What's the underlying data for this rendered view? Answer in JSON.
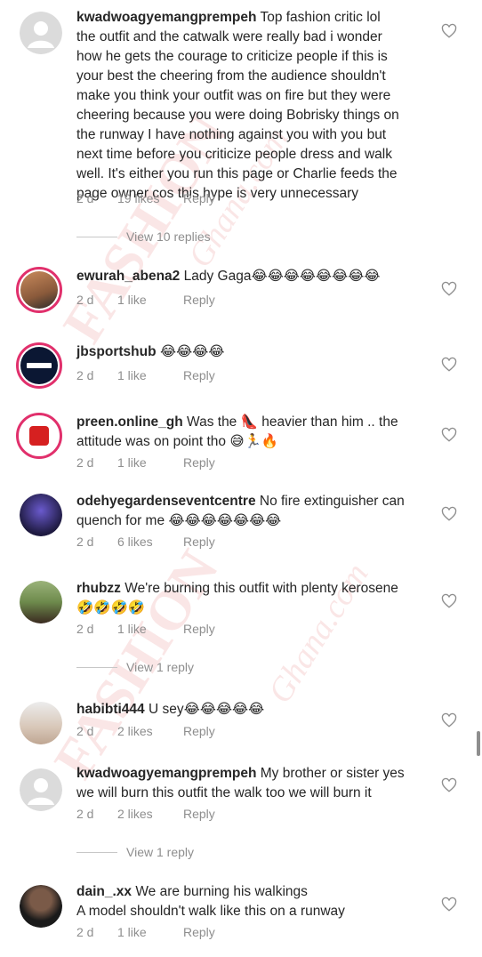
{
  "comments": [
    {
      "user": "kwadwoagyemangprempeh",
      "body_lines": [
        " Top fashion critic lol",
        "the outfit and the catwalk were really bad  i wonder",
        "how he gets the courage to criticize people if this is",
        "your best  the cheering from the audience shouldn't",
        "make you think your outfit was on fire  but they were",
        "cheering because you were doing Bobrisky things on",
        "the runway  I have nothing against you with you but",
        "next time before you criticize people dress and walk",
        "well.  It's either you run this page or Charlie feeds the",
        "page owner cos this hype is very unnecessary"
      ],
      "time": "2 d",
      "likes": "19 likes",
      "reply": "Reply",
      "view_replies": "View 10 replies"
    },
    {
      "user": "ewurah_abena2",
      "body_lines": [
        " Lady Gaga😂😂😂😂😂😂😂😂"
      ],
      "time": "2 d",
      "likes": "1 like",
      "reply": "Reply"
    },
    {
      "user": "jbsportshub",
      "body_lines": [
        " 😂😂😂😂"
      ],
      "time": "2 d",
      "likes": "1 like",
      "reply": "Reply"
    },
    {
      "user": "preen.online_gh",
      "body_lines": [
        " Was the 👠 heavier than him .. the",
        "attitude was on point tho 😅🏃🔥"
      ],
      "time": "2 d",
      "likes": "1 like",
      "reply": "Reply"
    },
    {
      "user": "odehyegardenseventcentre",
      "body_lines": [
        " No fire extinguisher can",
        "quench for me 😂😂😂😂😂😂😂"
      ],
      "time": "2 d",
      "likes": "6 likes",
      "reply": "Reply"
    },
    {
      "user": "rhubzz",
      "body_lines": [
        " We're burning this outfit with plenty kerosene",
        "🤣🤣🤣🤣"
      ],
      "time": "2 d",
      "likes": "1 like",
      "reply": "Reply",
      "view_replies": "View 1 reply"
    },
    {
      "user": "habibti444",
      "body_lines": [
        " U sey😂😂😂😂😂"
      ],
      "time": "2 d",
      "likes": "2 likes",
      "reply": "Reply"
    },
    {
      "user": "kwadwoagyemangprempeh",
      "body_lines": [
        " My brother or sister yes",
        "we will burn this outfit  the walk too  we will burn it"
      ],
      "time": "2 d",
      "likes": "2 likes",
      "reply": "Reply",
      "view_replies": "View 1 reply"
    },
    {
      "user": "dain_.xx",
      "body_lines": [
        " We are burning his walkings",
        " A model shouldn't walk like this on a runway"
      ],
      "time": "2 d",
      "likes": "1 like",
      "reply": "Reply"
    }
  ],
  "watermark": {
    "top_word": "FASHION",
    "top_sub": "Ghana.com",
    "bottom_word": "FASHION",
    "bottom_sub": "Ghana.com"
  },
  "icons": {
    "heart": "heart-outline-icon",
    "avatar_placeholder": "default-user-icon"
  }
}
